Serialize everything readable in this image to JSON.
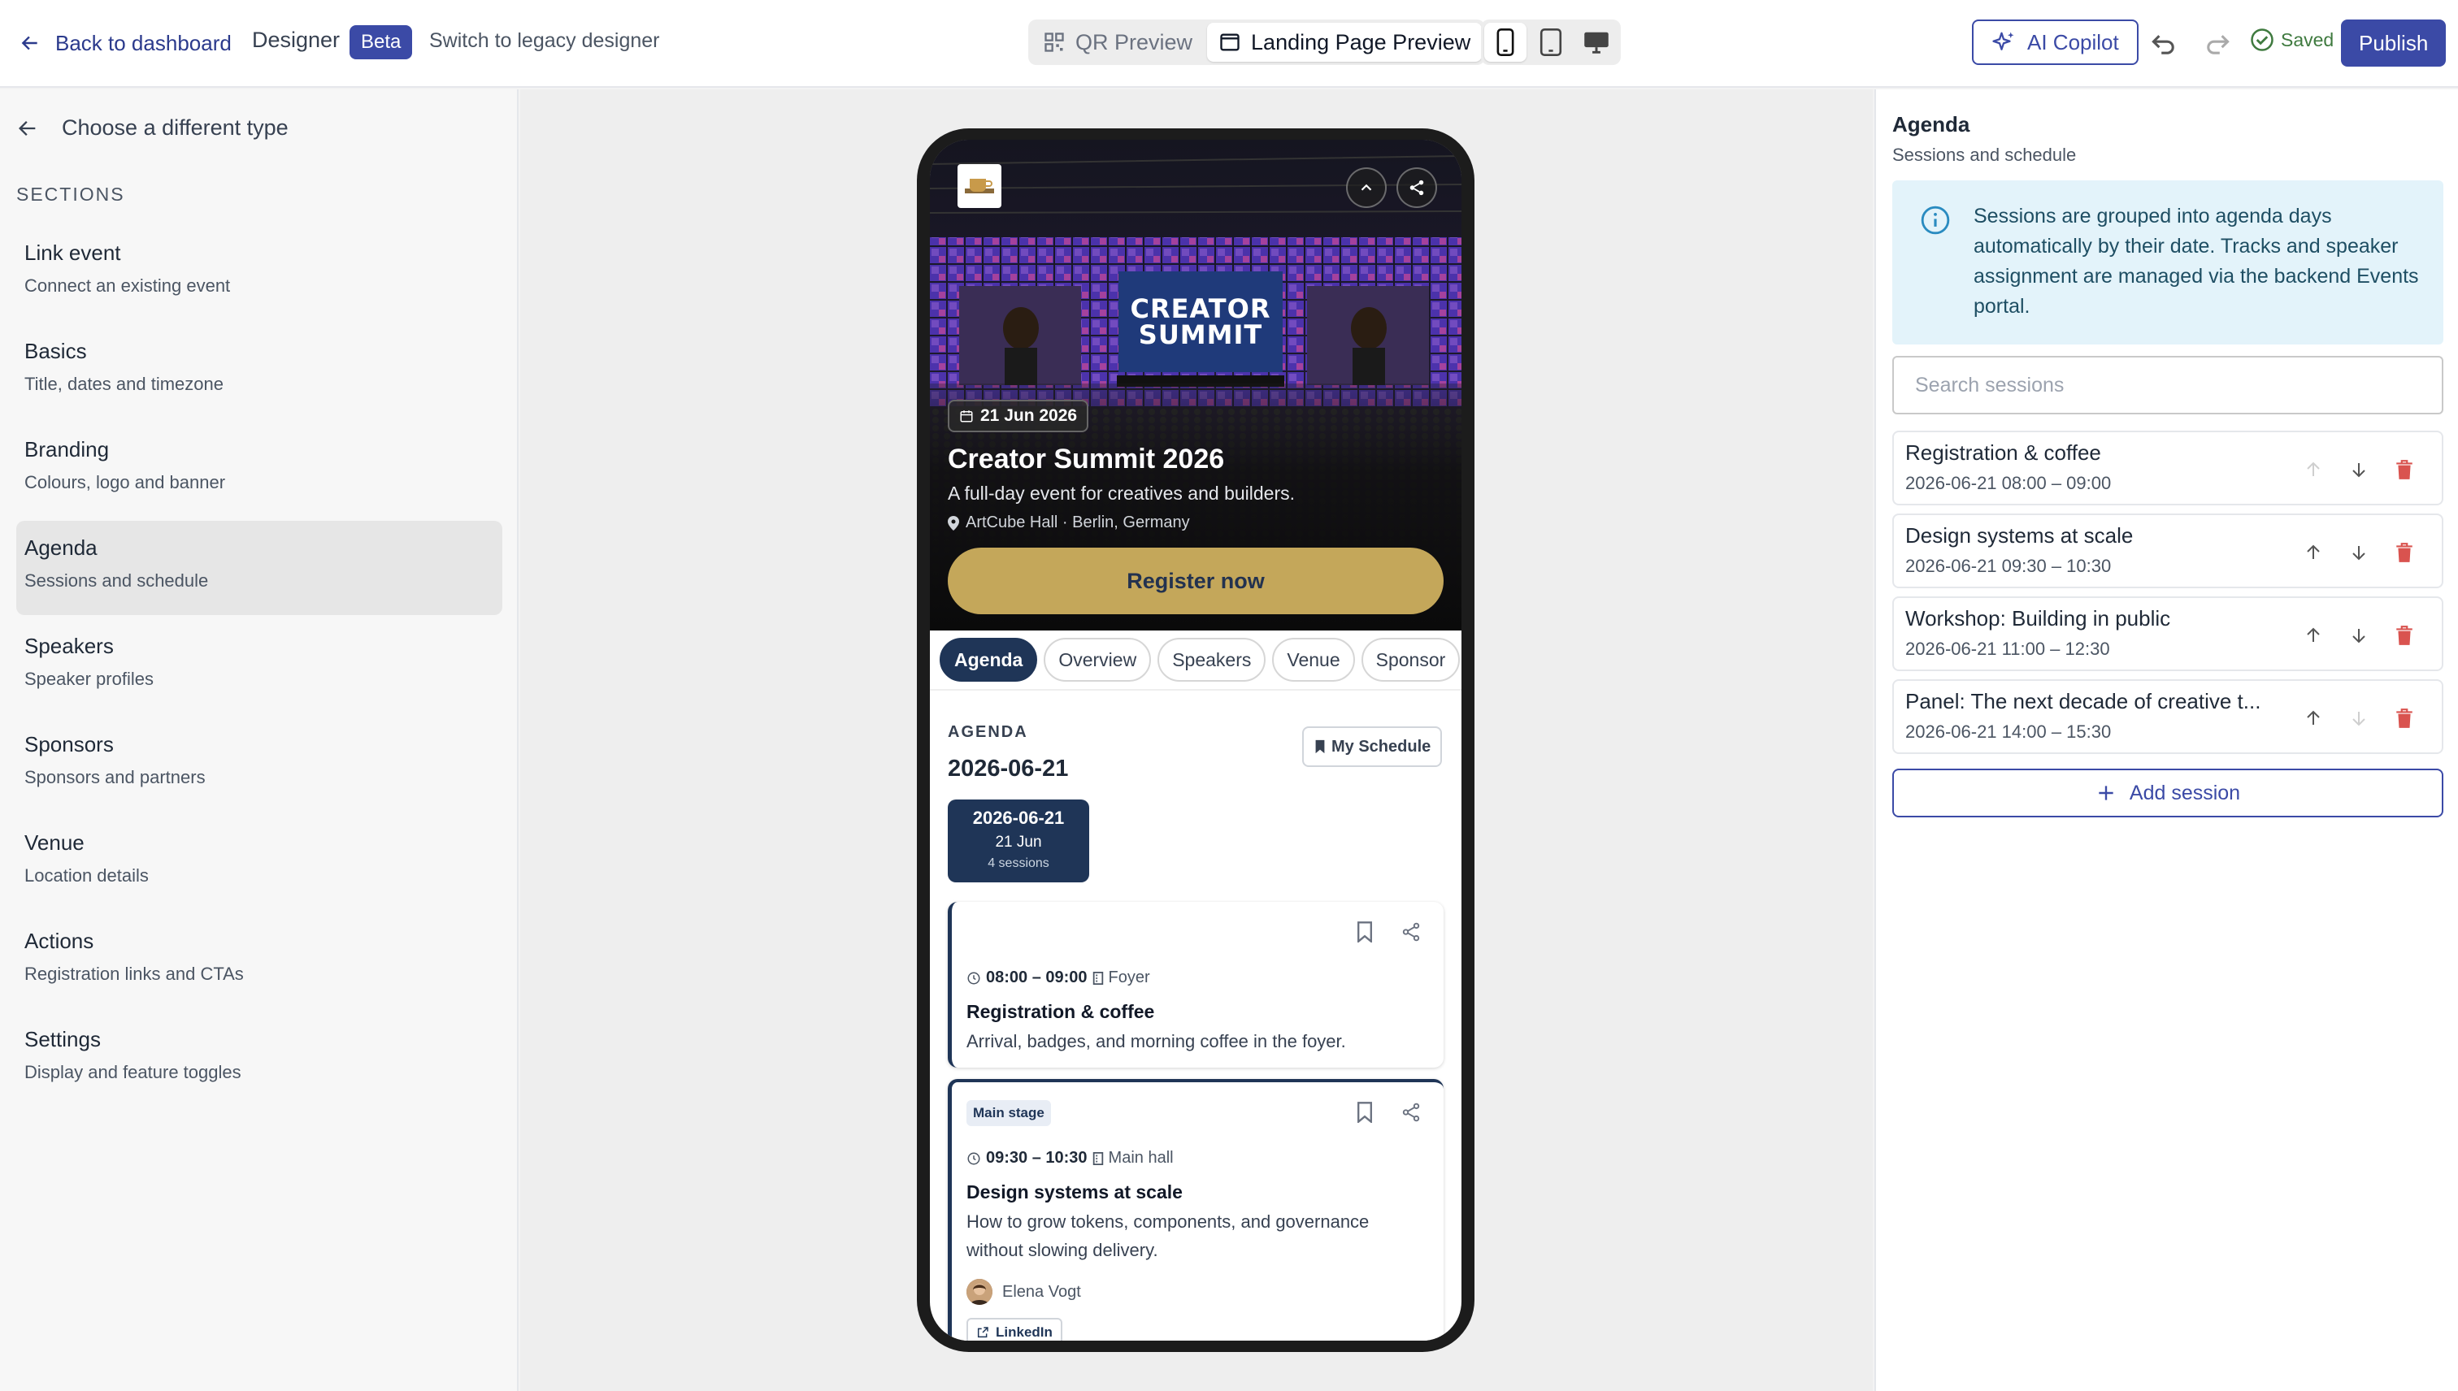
{
  "topbar": {
    "back_label": "Back to dashboard",
    "designer_label": "Designer",
    "beta_badge": "Beta",
    "legacy_link": "Switch to legacy designer",
    "preview_tabs": [
      {
        "label": "QR Preview",
        "icon": "qr-icon",
        "active": false
      },
      {
        "label": "Landing Page Preview",
        "icon": "window-icon",
        "active": true
      }
    ],
    "devices": [
      {
        "name": "phone",
        "active": true
      },
      {
        "name": "tablet",
        "active": false
      },
      {
        "name": "desktop",
        "active": false
      }
    ],
    "copilot_label": "AI Copilot",
    "saved_label": "Saved",
    "publish_label": "Publish"
  },
  "sidebar": {
    "back_label": "Choose a different type",
    "sections_heading": "SECTIONS",
    "items": [
      {
        "title": "Link event",
        "subtitle": "Connect an existing event",
        "active": false
      },
      {
        "title": "Basics",
        "subtitle": "Title, dates and timezone",
        "active": false
      },
      {
        "title": "Branding",
        "subtitle": "Colours, logo and banner",
        "active": false
      },
      {
        "title": "Agenda",
        "subtitle": "Sessions and schedule",
        "active": true
      },
      {
        "title": "Speakers",
        "subtitle": "Speaker profiles",
        "active": false
      },
      {
        "title": "Sponsors",
        "subtitle": "Sponsors and partners",
        "active": false
      },
      {
        "title": "Venue",
        "subtitle": "Location details",
        "active": false
      },
      {
        "title": "Actions",
        "subtitle": "Registration links and CTAs",
        "active": false
      },
      {
        "title": "Settings",
        "subtitle": "Display and feature toggles",
        "active": false
      }
    ]
  },
  "preview": {
    "hero_sign_line1": "CREATOR",
    "hero_sign_line2": "SUMMIT",
    "date_chip": "21 Jun 2026",
    "event_title": "Creator Summit 2026",
    "event_subtitle": "A full-day event for creatives and builders.",
    "event_location": "ArtCube Hall · Berlin, Germany",
    "register_label": "Register now",
    "tabs": [
      "Agenda",
      "Overview",
      "Speakers",
      "Venue",
      "Sponsor"
    ],
    "agenda_label": "AGENDA",
    "agenda_date": "2026-06-21",
    "my_schedule_label": "My Schedule",
    "day_card": {
      "date": "2026-06-21",
      "short": "21 Jun",
      "count": "4 sessions"
    },
    "sessions": [
      {
        "time": "08:00 – 09:00",
        "room": "Foyer",
        "title": "Registration & coffee",
        "desc": "Arrival, badges, and morning coffee in the foyer."
      },
      {
        "badge": "Main stage",
        "time": "09:30 – 10:30",
        "room": "Main hall",
        "title": "Design systems at scale",
        "desc": "How to grow tokens, components, and governance without slowing delivery.",
        "speaker": "Elena Vogt",
        "link_label": "LinkedIn"
      }
    ]
  },
  "panel": {
    "title": "Agenda",
    "subtitle": "Sessions and schedule",
    "info_text": "Sessions are grouped into agenda days automatically by their date. Tracks and speaker assignment are managed via the backend Events portal.",
    "search_placeholder": "Search sessions",
    "sessions": [
      {
        "name": "Registration & coffee",
        "time": "2026-06-21 08:00 – 09:00"
      },
      {
        "name": "Design systems at scale",
        "time": "2026-06-21 09:30 – 10:30"
      },
      {
        "name": "Workshop: Building in public",
        "time": "2026-06-21 11:00 – 12:30"
      },
      {
        "name": "Panel: The next decade of creative t...",
        "time": "2026-06-21 14:00 – 15:30"
      }
    ],
    "add_label": "Add session"
  },
  "colors": {
    "accent": "#3b4aa6",
    "navy": "#1f3557",
    "gold": "#c4a75a",
    "danger": "#d9534f",
    "info_bg": "#e3f3fa"
  }
}
